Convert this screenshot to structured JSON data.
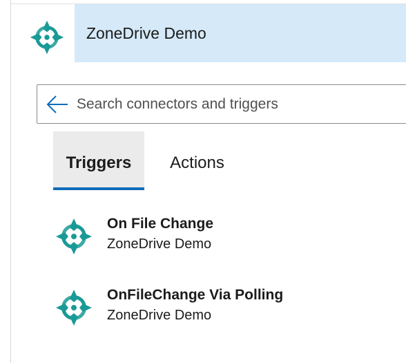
{
  "header": {
    "title": "ZoneDrive Demo",
    "logo_icon": "zonedrive-logo-icon",
    "band_color": "#d5e9f8"
  },
  "search": {
    "placeholder": "Search connectors and triggers",
    "value": "",
    "back_icon": "arrow-left-icon"
  },
  "tabs": [
    {
      "label": "Triggers",
      "selected": true
    },
    {
      "label": "Actions",
      "selected": false
    }
  ],
  "items": [
    {
      "title": "On File Change",
      "subtitle": "ZoneDrive Demo",
      "icon": "zonedrive-logo-icon"
    },
    {
      "title": "OnFileChange Via Polling",
      "subtitle": "ZoneDrive Demo",
      "icon": "zonedrive-logo-icon"
    }
  ],
  "colors": {
    "accent": "#0f6cbd",
    "brand": "#1a9a96",
    "selected_tab_bg": "#ebebeb"
  }
}
